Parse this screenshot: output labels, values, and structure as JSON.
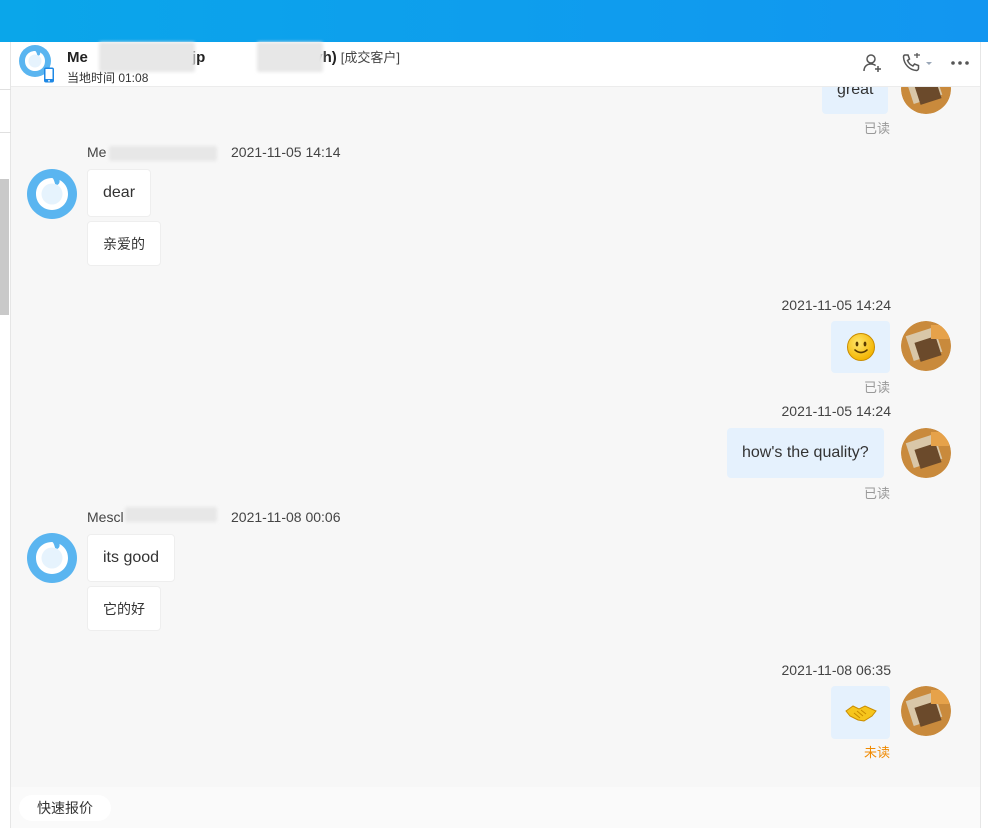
{
  "header": {
    "contact_name_start": "Me",
    "contact_name_mid": "auchi(jp",
    "contact_name_end": "5678ocyh)",
    "contact_tag": "[成交客户]",
    "local_time": "当地时间 01:08",
    "icons": [
      "contact-add-icon",
      "phone-call-icon",
      "dropdown-caret-icon",
      "more-icon"
    ]
  },
  "messages": {
    "top_out": {
      "text": "great",
      "status": "已读"
    },
    "in1": {
      "sender": "Me",
      "time": "2021-11-05 14:14",
      "text": "dear",
      "translation": "亲爱的"
    },
    "out1": {
      "time": "2021-11-05 14:24",
      "content": "smile-emoji",
      "status": "已读"
    },
    "out2": {
      "time": "2021-11-05 14:24",
      "text": "how's the quality?",
      "status": "已读"
    },
    "in2": {
      "sender": "Mescl",
      "time": "2021-11-08 00:06",
      "text": "its good",
      "translation": "它的好"
    },
    "out3": {
      "time": "2021-11-08 06:35",
      "content": "handshake-emoji",
      "status": "未读"
    }
  },
  "footer": {
    "quick_quote": "快速报价"
  },
  "colors": {
    "topbar": "#0aa6ea",
    "outgoing_bubble": "#e5f1fd",
    "unread": "#f08a00",
    "read": "#999999"
  }
}
